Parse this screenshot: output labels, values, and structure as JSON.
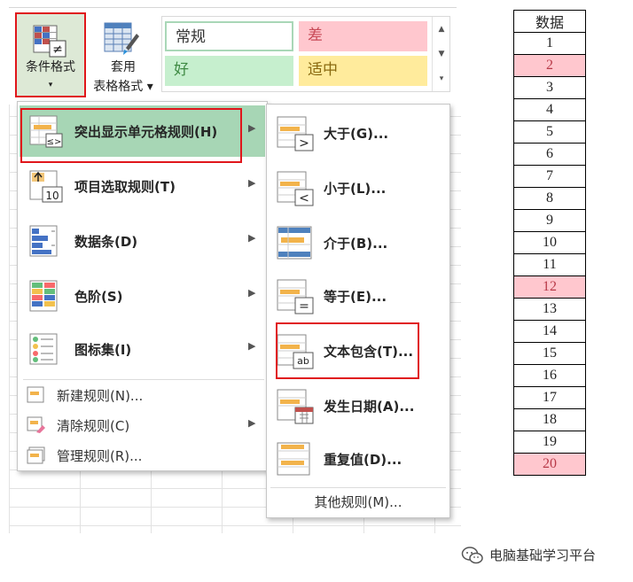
{
  "ribbon": {
    "conditional_formatting_label": "条件格式",
    "conditional_formatting_arrow": "▾",
    "format_table_label_1": "套用",
    "format_table_label_2": "表格格式 ▾",
    "styles": {
      "normal": "常规",
      "bad": "差",
      "good": "好",
      "neutral": "适中"
    },
    "gallery_scroll": {
      "up": "▲",
      "down": "▼",
      "more": "▾"
    }
  },
  "menu": {
    "items": [
      {
        "label": "突出显示单元格规则(H)",
        "icon": "highlight-cells-icon",
        "arrow": "▶"
      },
      {
        "label": "项目选取规则(T)",
        "icon": "top-bottom-icon",
        "icon_text": "10",
        "arrow": "▶"
      },
      {
        "label": "数据条(D)",
        "icon": "data-bars-icon",
        "arrow": "▶"
      },
      {
        "label": "色阶(S)",
        "icon": "color-scales-icon",
        "arrow": "▶"
      },
      {
        "label": "图标集(I)",
        "icon": "icon-sets-icon",
        "arrow": "▶"
      }
    ],
    "small_items": [
      {
        "label": "新建规则(N)...",
        "icon": "new-rule-icon"
      },
      {
        "label": "清除规则(C)",
        "icon": "clear-rules-icon",
        "arrow": "▶"
      },
      {
        "label": "管理规则(R)...",
        "icon": "manage-rules-icon"
      }
    ]
  },
  "submenu": {
    "items": [
      {
        "label": "大于(G)...",
        "icon": "greater-than-icon",
        "symbol": ">"
      },
      {
        "label": "小于(L)...",
        "icon": "less-than-icon",
        "symbol": "<"
      },
      {
        "label": "介于(B)...",
        "icon": "between-icon"
      },
      {
        "label": "等于(E)...",
        "icon": "equal-to-icon",
        "symbol": "="
      },
      {
        "label": "文本包含(T)...",
        "icon": "text-contains-icon",
        "symbol": "ab"
      },
      {
        "label": "发生日期(A)...",
        "icon": "date-occurring-icon"
      },
      {
        "label": "重复值(D)...",
        "icon": "duplicate-values-icon"
      }
    ],
    "other_rules": "其他规则(M)..."
  },
  "data_column": {
    "header": "数据",
    "rows": [
      {
        "value": "1",
        "highlighted": false
      },
      {
        "value": "2",
        "highlighted": true
      },
      {
        "value": "3",
        "highlighted": false
      },
      {
        "value": "4",
        "highlighted": false
      },
      {
        "value": "5",
        "highlighted": false
      },
      {
        "value": "6",
        "highlighted": false
      },
      {
        "value": "7",
        "highlighted": false
      },
      {
        "value": "8",
        "highlighted": false
      },
      {
        "value": "9",
        "highlighted": false
      },
      {
        "value": "10",
        "highlighted": false
      },
      {
        "value": "11",
        "highlighted": false
      },
      {
        "value": "12",
        "highlighted": true
      },
      {
        "value": "13",
        "highlighted": false
      },
      {
        "value": "14",
        "highlighted": false
      },
      {
        "value": "15",
        "highlighted": false
      },
      {
        "value": "16",
        "highlighted": false
      },
      {
        "value": "17",
        "highlighted": false
      },
      {
        "value": "18",
        "highlighted": false
      },
      {
        "value": "19",
        "highlighted": false
      },
      {
        "value": "20",
        "highlighted": true
      }
    ]
  },
  "watermark": {
    "text": "电脑基础学习平台",
    "icon": "wechat-logo-icon"
  },
  "colors": {
    "selected_menu_bg": "#a7d6b5",
    "red_frame": "#e0161b",
    "highlight_fill": "#ffc7ce",
    "highlight_text": "#b83a48"
  }
}
